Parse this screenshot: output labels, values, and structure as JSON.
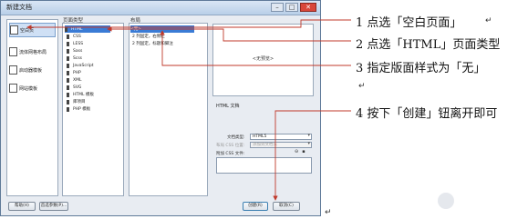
{
  "dialog": {
    "title": "新建文档",
    "window_buttons": [
      "–",
      "□",
      "✕"
    ],
    "categories": [
      {
        "label": "空白页",
        "icon": "blank-page-icon"
      },
      {
        "label": "流体网格布局",
        "icon": "fluid-grid-icon"
      },
      {
        "label": "启动器模板",
        "icon": "starter-template-icon"
      },
      {
        "label": "网站模板",
        "icon": "site-template-icon"
      }
    ],
    "page_type_header": "页面类型",
    "page_types": [
      "HTML",
      "CSS",
      "LESS",
      "Sass",
      "Scss",
      "JavaScript",
      "PHP",
      "XML",
      "SVG",
      "HTML 模板",
      "库项目",
      "PHP 模板"
    ],
    "layout_header": "布局",
    "layouts": [
      "<无>",
      "2 列固定，右侧栏",
      "2 列固定，标题和脚注"
    ],
    "preview_text": "<无预览>",
    "description": "HTML 文档",
    "doctype_label": "文档类型:",
    "doctype_value": "HTML5",
    "layout_css_label": "布局 CSS 位置:",
    "layout_css_value": "添加到文档头",
    "attach_css_label": "附加 CSS 文件:",
    "help_button": "帮助(H)",
    "prefs_button": "首选参数(P)...",
    "create_button": "创建(R)",
    "cancel_button": "取消(C)"
  },
  "annotations": [
    "1 点选「空白页面」",
    "2 点选「HTML」页面类型",
    "3 指定版面样式为「无」",
    "4 按下「创建」钮离开即可"
  ],
  "para_mark": "↵",
  "colors": {
    "arrow": "#c0392b",
    "selection": "#3a7bd5"
  }
}
